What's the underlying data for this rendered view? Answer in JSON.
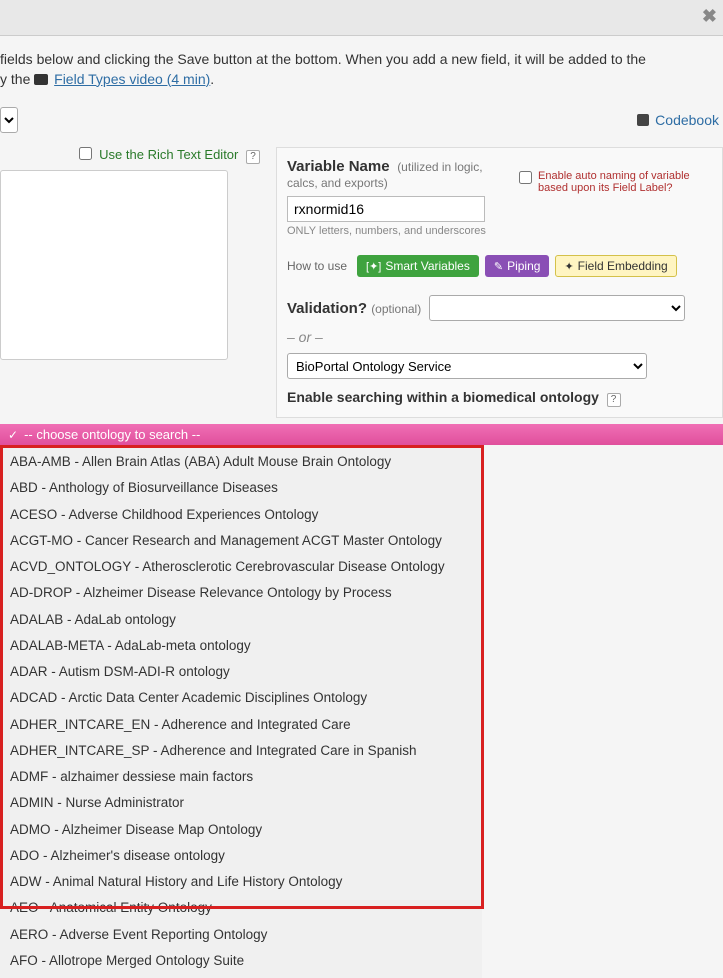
{
  "intro": {
    "line1": "fields below and clicking the Save button at the bottom. When you add a new field, it will be added to the",
    "line2_prefix": "y the ",
    "video_link": "Field Types video (4 min)"
  },
  "codebook": "Codebook",
  "rte": {
    "label": "Use the Rich Text Editor"
  },
  "variable": {
    "title": "Variable Name",
    "hint": "(utilized in logic, calcs, and exports)",
    "value": "rxnormid16",
    "note": "ONLY letters, numbers, and underscores",
    "auto_naming": "Enable auto naming of variable based upon its Field Label?"
  },
  "howto": {
    "label": "How to use",
    "smart": "Smart Variables",
    "piping": "Piping",
    "embed": "Field Embedding"
  },
  "validation": {
    "label": "Validation?",
    "optional": "(optional)",
    "or": "– or –",
    "bioportal": "BioPortal Ontology Service",
    "enable_search": "Enable searching within a biomedical ontology"
  },
  "ontology_header": "-- choose ontology to search --",
  "ontologies": [
    "ABA-AMB - Allen Brain Atlas (ABA) Adult Mouse Brain Ontology",
    "ABD - Anthology of Biosurveillance Diseases",
    "ACESO - Adverse Childhood Experiences Ontology",
    "ACGT-MO - Cancer Research and Management ACGT Master Ontology",
    "ACVD_ONTOLOGY - Atherosclerotic Cerebrovascular Disease Ontology",
    "AD-DROP - Alzheimer Disease Relevance Ontology by Process",
    "ADALAB - AdaLab ontology",
    "ADALAB-META - AdaLab-meta ontology",
    "ADAR - Autism DSM-ADI-R ontology",
    "ADCAD - Arctic Data Center Academic Disciplines Ontology",
    "ADHER_INTCARE_EN - Adherence and Integrated Care",
    "ADHER_INTCARE_SP - Adherence and Integrated Care in Spanish",
    "ADMF - alzhaimer dessiese main factors",
    "ADMIN - Nurse Administrator",
    "ADMO - Alzheimer Disease Map Ontology",
    "ADO - Alzheimer's disease ontology",
    "ADW - Animal Natural History and Life History Ontology",
    "AEO - Anatomical Entity Ontology",
    "AERO - Adverse Event Reporting Ontology",
    "AFO - Allotrope Merged Ontology Suite"
  ]
}
